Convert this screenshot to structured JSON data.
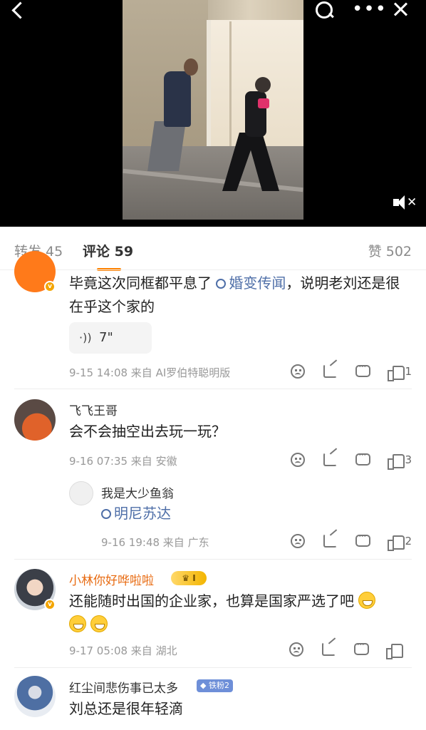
{
  "tabs": {
    "repost": "转发 45",
    "comment": "评论 59",
    "like": "赞 502"
  },
  "comments": [
    {
      "text_before": "毕竟这次同框都平息了",
      "link": "婚变传闻",
      "text_after": "，说明老刘还是很在乎这个家的",
      "voice_length": "7\"",
      "meta": "9-15 14:08 来自 AI罗伯特聪明版",
      "likes": "1"
    },
    {
      "username": "飞飞王哥",
      "text": "会不会抽空出去玩一玩？",
      "meta": "9-16 07:35 来自 安徽",
      "likes": "3"
    },
    {
      "username": "我是大少鱼翁",
      "link": "明尼苏达",
      "meta": "9-16 19:48 来自 广东",
      "likes": "2"
    },
    {
      "username": "小林你好哗啦啦",
      "badge": "I",
      "text": "还能随时出国的企业家，也算是国家严选了吧",
      "meta": "9-17 05:08 来自 湖北",
      "likes": ""
    },
    {
      "username": "红尘间悲伤事已太多",
      "badge": "铁粉2",
      "text": "刘总还是很年轻滴"
    }
  ],
  "icons": {
    "back": "back-icon",
    "search": "search-icon",
    "more": "more-icon",
    "close": "close-icon",
    "mute": "mute-icon"
  },
  "colors": {
    "accent": "#ff8200",
    "link": "#4f6fa8",
    "vip_name": "#e86b12"
  }
}
